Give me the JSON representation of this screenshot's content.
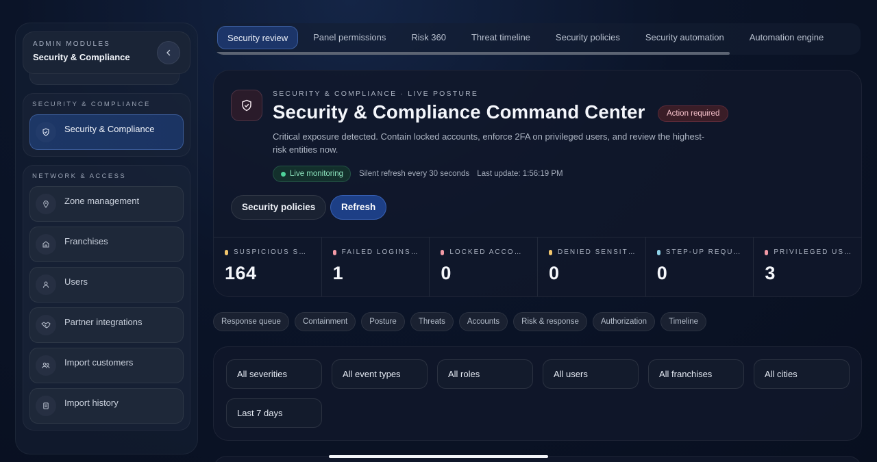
{
  "sidebar": {
    "header": {
      "eyebrow": "ADMIN MODULES",
      "title": "Security & Compliance"
    },
    "groups": [
      {
        "label": "SECURITY & COMPLIANCE",
        "items": [
          {
            "label": "Security & Compliance",
            "icon": "shield-check-icon",
            "active": true
          }
        ]
      },
      {
        "label": "NETWORK & ACCESS",
        "items": [
          {
            "label": "Zone management",
            "icon": "map-pin-icon"
          },
          {
            "label": "Franchises",
            "icon": "storefront-icon"
          },
          {
            "label": "Users",
            "icon": "user-icon"
          },
          {
            "label": "Partner integrations",
            "icon": "handshake-icon"
          },
          {
            "label": "Import customers",
            "icon": "users-icon"
          },
          {
            "label": "Import history",
            "icon": "document-icon"
          }
        ]
      }
    ]
  },
  "tabs": [
    {
      "label": "Security review",
      "active": true
    },
    {
      "label": "Panel permissions"
    },
    {
      "label": "Risk 360"
    },
    {
      "label": "Threat timeline"
    },
    {
      "label": "Security policies"
    },
    {
      "label": "Security automation"
    },
    {
      "label": "Automation engine"
    }
  ],
  "hero": {
    "eyebrow": "SECURITY & COMPLIANCE · LIVE POSTURE",
    "title": "Security & Compliance Command Center",
    "badge": "Action required",
    "description": "Critical exposure detected. Contain locked accounts, enforce 2FA on privileged users, and review the highest-risk entities now.",
    "live_label": "Live monitoring",
    "refresh_note": "Silent refresh every 30 seconds",
    "last_update": "Last update: 1:56:19 PM",
    "secondary_button": "Security policies",
    "primary_button": "Refresh"
  },
  "metrics": [
    {
      "label": "SUSPICIOUS SE…",
      "value": "164",
      "color": "#f2c66d"
    },
    {
      "label": "FAILED LOGINS …",
      "value": "1",
      "color": "#f29aa6"
    },
    {
      "label": "LOCKED ACCOU…",
      "value": "0",
      "color": "#f29aa6"
    },
    {
      "label": "DENIED SENSITI…",
      "value": "0",
      "color": "#f2c66d"
    },
    {
      "label": "STEP-UP REQUI…",
      "value": "0",
      "color": "#8fd3e8"
    },
    {
      "label": "PRIVILEGED US…",
      "value": "3",
      "color": "#f29aa6"
    }
  ],
  "chips": [
    "Response queue",
    "Containment",
    "Posture",
    "Threats",
    "Accounts",
    "Risk & response",
    "Authorization",
    "Timeline"
  ],
  "filters": [
    "All severities",
    "All event types",
    "All roles",
    "All users",
    "All franchises",
    "All cities",
    "Last 7 days"
  ]
}
